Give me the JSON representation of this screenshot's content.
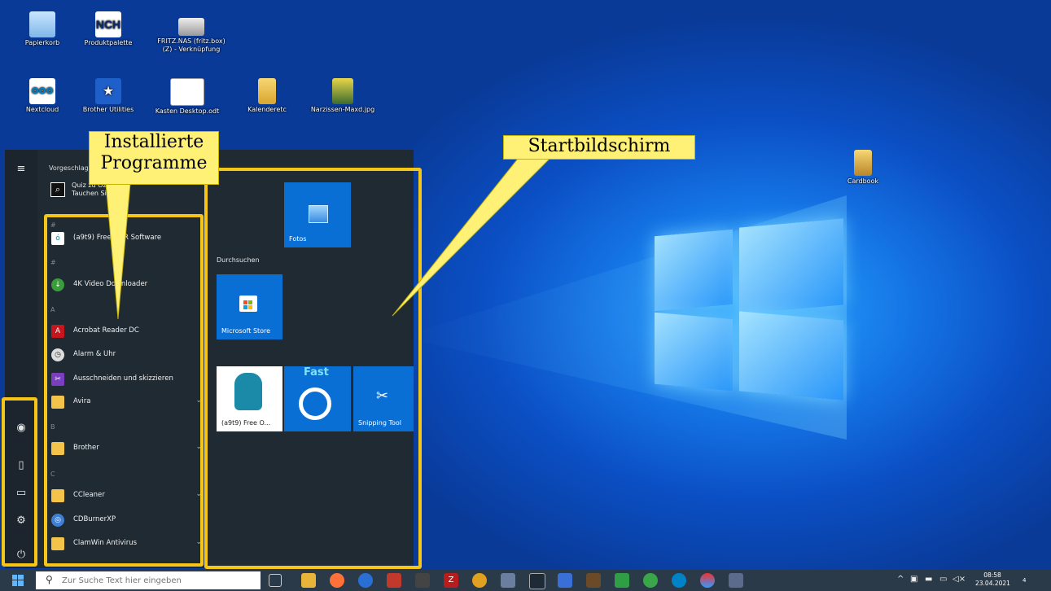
{
  "desktop": {
    "icons": [
      {
        "label": "Papierkorb"
      },
      {
        "label": "Produktpalette"
      },
      {
        "label": "FRITZ.NAS (fritz.box)\n(Z) - Verknüpfung"
      },
      {
        "label": "Nextcloud"
      },
      {
        "label": "Brother Utilities"
      },
      {
        "label": "Kasten Desktop.odt"
      },
      {
        "label": "Kalenderetc"
      },
      {
        "label": "Narzissen-Maxd.jpg"
      },
      {
        "label": "Cardbook"
      }
    ]
  },
  "start_menu": {
    "suggested_header": "Vorgeschlagen",
    "suggestion": {
      "line1": "Quiz zu Oz",
      "line2": "Tauchen Sie"
    },
    "apps": [
      {
        "label": "(a9t9) Free OCR Software",
        "folder": false
      },
      {
        "label": "4K Video Downloader",
        "folder": false
      },
      {
        "label": "Acrobat Reader DC",
        "folder": false
      },
      {
        "label": "Alarm & Uhr",
        "folder": false
      },
      {
        "label": "Ausschneiden und skizzieren",
        "folder": false
      },
      {
        "label": "Avira",
        "folder": true
      },
      {
        "label": "Brother",
        "folder": true
      },
      {
        "label": "CCleaner",
        "folder": true
      },
      {
        "label": "CDBurnerXP",
        "folder": false
      },
      {
        "label": "ClamWin Antivirus",
        "folder": true
      }
    ],
    "letters": [
      "#",
      "A",
      "B",
      "C"
    ],
    "tiles": {
      "fotos": "Fotos",
      "group_label": "Durchsuchen",
      "store": "Microsoft Store",
      "ocr": "(a9t9) Free O...",
      "ocr_brand": "Fast",
      "snipping": "Snipping Tool"
    }
  },
  "annotations": {
    "installed": "Installierte\nProgramme",
    "startscreen": "Startbildschirm"
  },
  "taskbar": {
    "search_placeholder": "Zur Suche Text hier eingeben",
    "time": "08:58",
    "date": "23.04.2021",
    "notification_count": "4"
  },
  "colors": {
    "annotation_yellow": "#f5c518",
    "callout_fill": "#fff176",
    "tile_blue": "#0a6fd4",
    "menu_bg": "#1f2a33",
    "taskbar_bg": "#2b3a49"
  }
}
